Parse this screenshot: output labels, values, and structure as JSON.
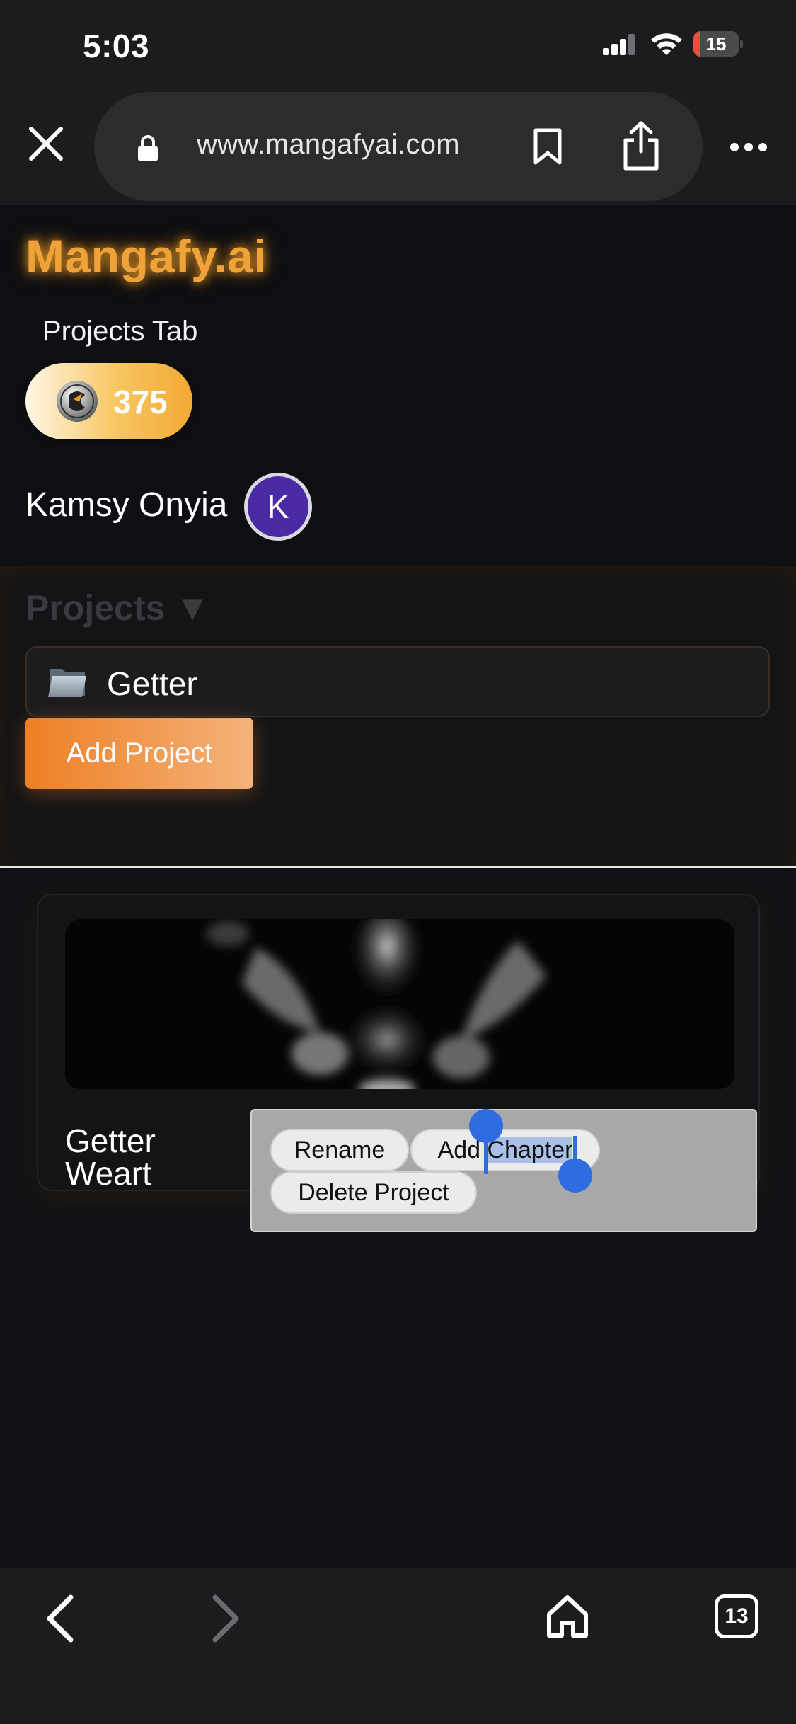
{
  "status_bar": {
    "time": "5:03",
    "battery_level": "15",
    "battery_fraction": 0.15
  },
  "browser": {
    "url": "www.mangafyai.com"
  },
  "header": {
    "logo": "Mangafy.ai",
    "tab_label": "Projects Tab",
    "coins": "375",
    "user_name": "Kamsy Onyia",
    "avatar_initial": "K"
  },
  "projects": {
    "heading": "Projects ▼",
    "items": [
      {
        "label": "Getter"
      }
    ],
    "add_button": "Add Project"
  },
  "card": {
    "title_line1": "Getter",
    "title_line2": "Weart"
  },
  "context_menu": {
    "rename": "Rename",
    "add_chapter_prefix": "Add ",
    "add_chapter_selected": "Chapter",
    "delete": "Delete Project"
  },
  "bottom_bar": {
    "tab_count": "13"
  },
  "colors": {
    "accent_orange": "#ee7f24",
    "logo_glow": "#f0a23a",
    "avatar_bg": "#4b2ba3",
    "selection_blue": "#2e6de0"
  }
}
